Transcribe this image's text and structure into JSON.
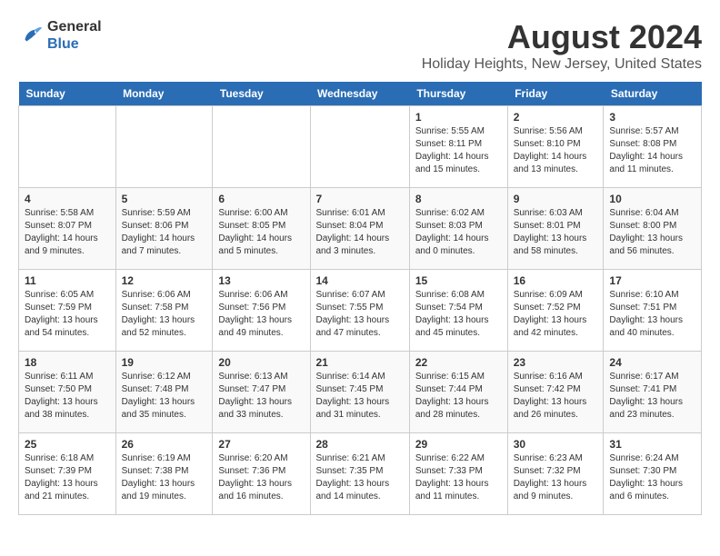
{
  "header": {
    "logo_line1": "General",
    "logo_line2": "Blue",
    "main_title": "August 2024",
    "subtitle": "Holiday Heights, New Jersey, United States"
  },
  "weekdays": [
    "Sunday",
    "Monday",
    "Tuesday",
    "Wednesday",
    "Thursday",
    "Friday",
    "Saturday"
  ],
  "weeks": [
    [
      {
        "num": "",
        "info": ""
      },
      {
        "num": "",
        "info": ""
      },
      {
        "num": "",
        "info": ""
      },
      {
        "num": "",
        "info": ""
      },
      {
        "num": "1",
        "info": "Sunrise: 5:55 AM\nSunset: 8:11 PM\nDaylight: 14 hours and 15 minutes."
      },
      {
        "num": "2",
        "info": "Sunrise: 5:56 AM\nSunset: 8:10 PM\nDaylight: 14 hours and 13 minutes."
      },
      {
        "num": "3",
        "info": "Sunrise: 5:57 AM\nSunset: 8:08 PM\nDaylight: 14 hours and 11 minutes."
      }
    ],
    [
      {
        "num": "4",
        "info": "Sunrise: 5:58 AM\nSunset: 8:07 PM\nDaylight: 14 hours and 9 minutes."
      },
      {
        "num": "5",
        "info": "Sunrise: 5:59 AM\nSunset: 8:06 PM\nDaylight: 14 hours and 7 minutes."
      },
      {
        "num": "6",
        "info": "Sunrise: 6:00 AM\nSunset: 8:05 PM\nDaylight: 14 hours and 5 minutes."
      },
      {
        "num": "7",
        "info": "Sunrise: 6:01 AM\nSunset: 8:04 PM\nDaylight: 14 hours and 3 minutes."
      },
      {
        "num": "8",
        "info": "Sunrise: 6:02 AM\nSunset: 8:03 PM\nDaylight: 14 hours and 0 minutes."
      },
      {
        "num": "9",
        "info": "Sunrise: 6:03 AM\nSunset: 8:01 PM\nDaylight: 13 hours and 58 minutes."
      },
      {
        "num": "10",
        "info": "Sunrise: 6:04 AM\nSunset: 8:00 PM\nDaylight: 13 hours and 56 minutes."
      }
    ],
    [
      {
        "num": "11",
        "info": "Sunrise: 6:05 AM\nSunset: 7:59 PM\nDaylight: 13 hours and 54 minutes."
      },
      {
        "num": "12",
        "info": "Sunrise: 6:06 AM\nSunset: 7:58 PM\nDaylight: 13 hours and 52 minutes."
      },
      {
        "num": "13",
        "info": "Sunrise: 6:06 AM\nSunset: 7:56 PM\nDaylight: 13 hours and 49 minutes."
      },
      {
        "num": "14",
        "info": "Sunrise: 6:07 AM\nSunset: 7:55 PM\nDaylight: 13 hours and 47 minutes."
      },
      {
        "num": "15",
        "info": "Sunrise: 6:08 AM\nSunset: 7:54 PM\nDaylight: 13 hours and 45 minutes."
      },
      {
        "num": "16",
        "info": "Sunrise: 6:09 AM\nSunset: 7:52 PM\nDaylight: 13 hours and 42 minutes."
      },
      {
        "num": "17",
        "info": "Sunrise: 6:10 AM\nSunset: 7:51 PM\nDaylight: 13 hours and 40 minutes."
      }
    ],
    [
      {
        "num": "18",
        "info": "Sunrise: 6:11 AM\nSunset: 7:50 PM\nDaylight: 13 hours and 38 minutes."
      },
      {
        "num": "19",
        "info": "Sunrise: 6:12 AM\nSunset: 7:48 PM\nDaylight: 13 hours and 35 minutes."
      },
      {
        "num": "20",
        "info": "Sunrise: 6:13 AM\nSunset: 7:47 PM\nDaylight: 13 hours and 33 minutes."
      },
      {
        "num": "21",
        "info": "Sunrise: 6:14 AM\nSunset: 7:45 PM\nDaylight: 13 hours and 31 minutes."
      },
      {
        "num": "22",
        "info": "Sunrise: 6:15 AM\nSunset: 7:44 PM\nDaylight: 13 hours and 28 minutes."
      },
      {
        "num": "23",
        "info": "Sunrise: 6:16 AM\nSunset: 7:42 PM\nDaylight: 13 hours and 26 minutes."
      },
      {
        "num": "24",
        "info": "Sunrise: 6:17 AM\nSunset: 7:41 PM\nDaylight: 13 hours and 23 minutes."
      }
    ],
    [
      {
        "num": "25",
        "info": "Sunrise: 6:18 AM\nSunset: 7:39 PM\nDaylight: 13 hours and 21 minutes."
      },
      {
        "num": "26",
        "info": "Sunrise: 6:19 AM\nSunset: 7:38 PM\nDaylight: 13 hours and 19 minutes."
      },
      {
        "num": "27",
        "info": "Sunrise: 6:20 AM\nSunset: 7:36 PM\nDaylight: 13 hours and 16 minutes."
      },
      {
        "num": "28",
        "info": "Sunrise: 6:21 AM\nSunset: 7:35 PM\nDaylight: 13 hours and 14 minutes."
      },
      {
        "num": "29",
        "info": "Sunrise: 6:22 AM\nSunset: 7:33 PM\nDaylight: 13 hours and 11 minutes."
      },
      {
        "num": "30",
        "info": "Sunrise: 6:23 AM\nSunset: 7:32 PM\nDaylight: 13 hours and 9 minutes."
      },
      {
        "num": "31",
        "info": "Sunrise: 6:24 AM\nSunset: 7:30 PM\nDaylight: 13 hours and 6 minutes."
      }
    ]
  ]
}
